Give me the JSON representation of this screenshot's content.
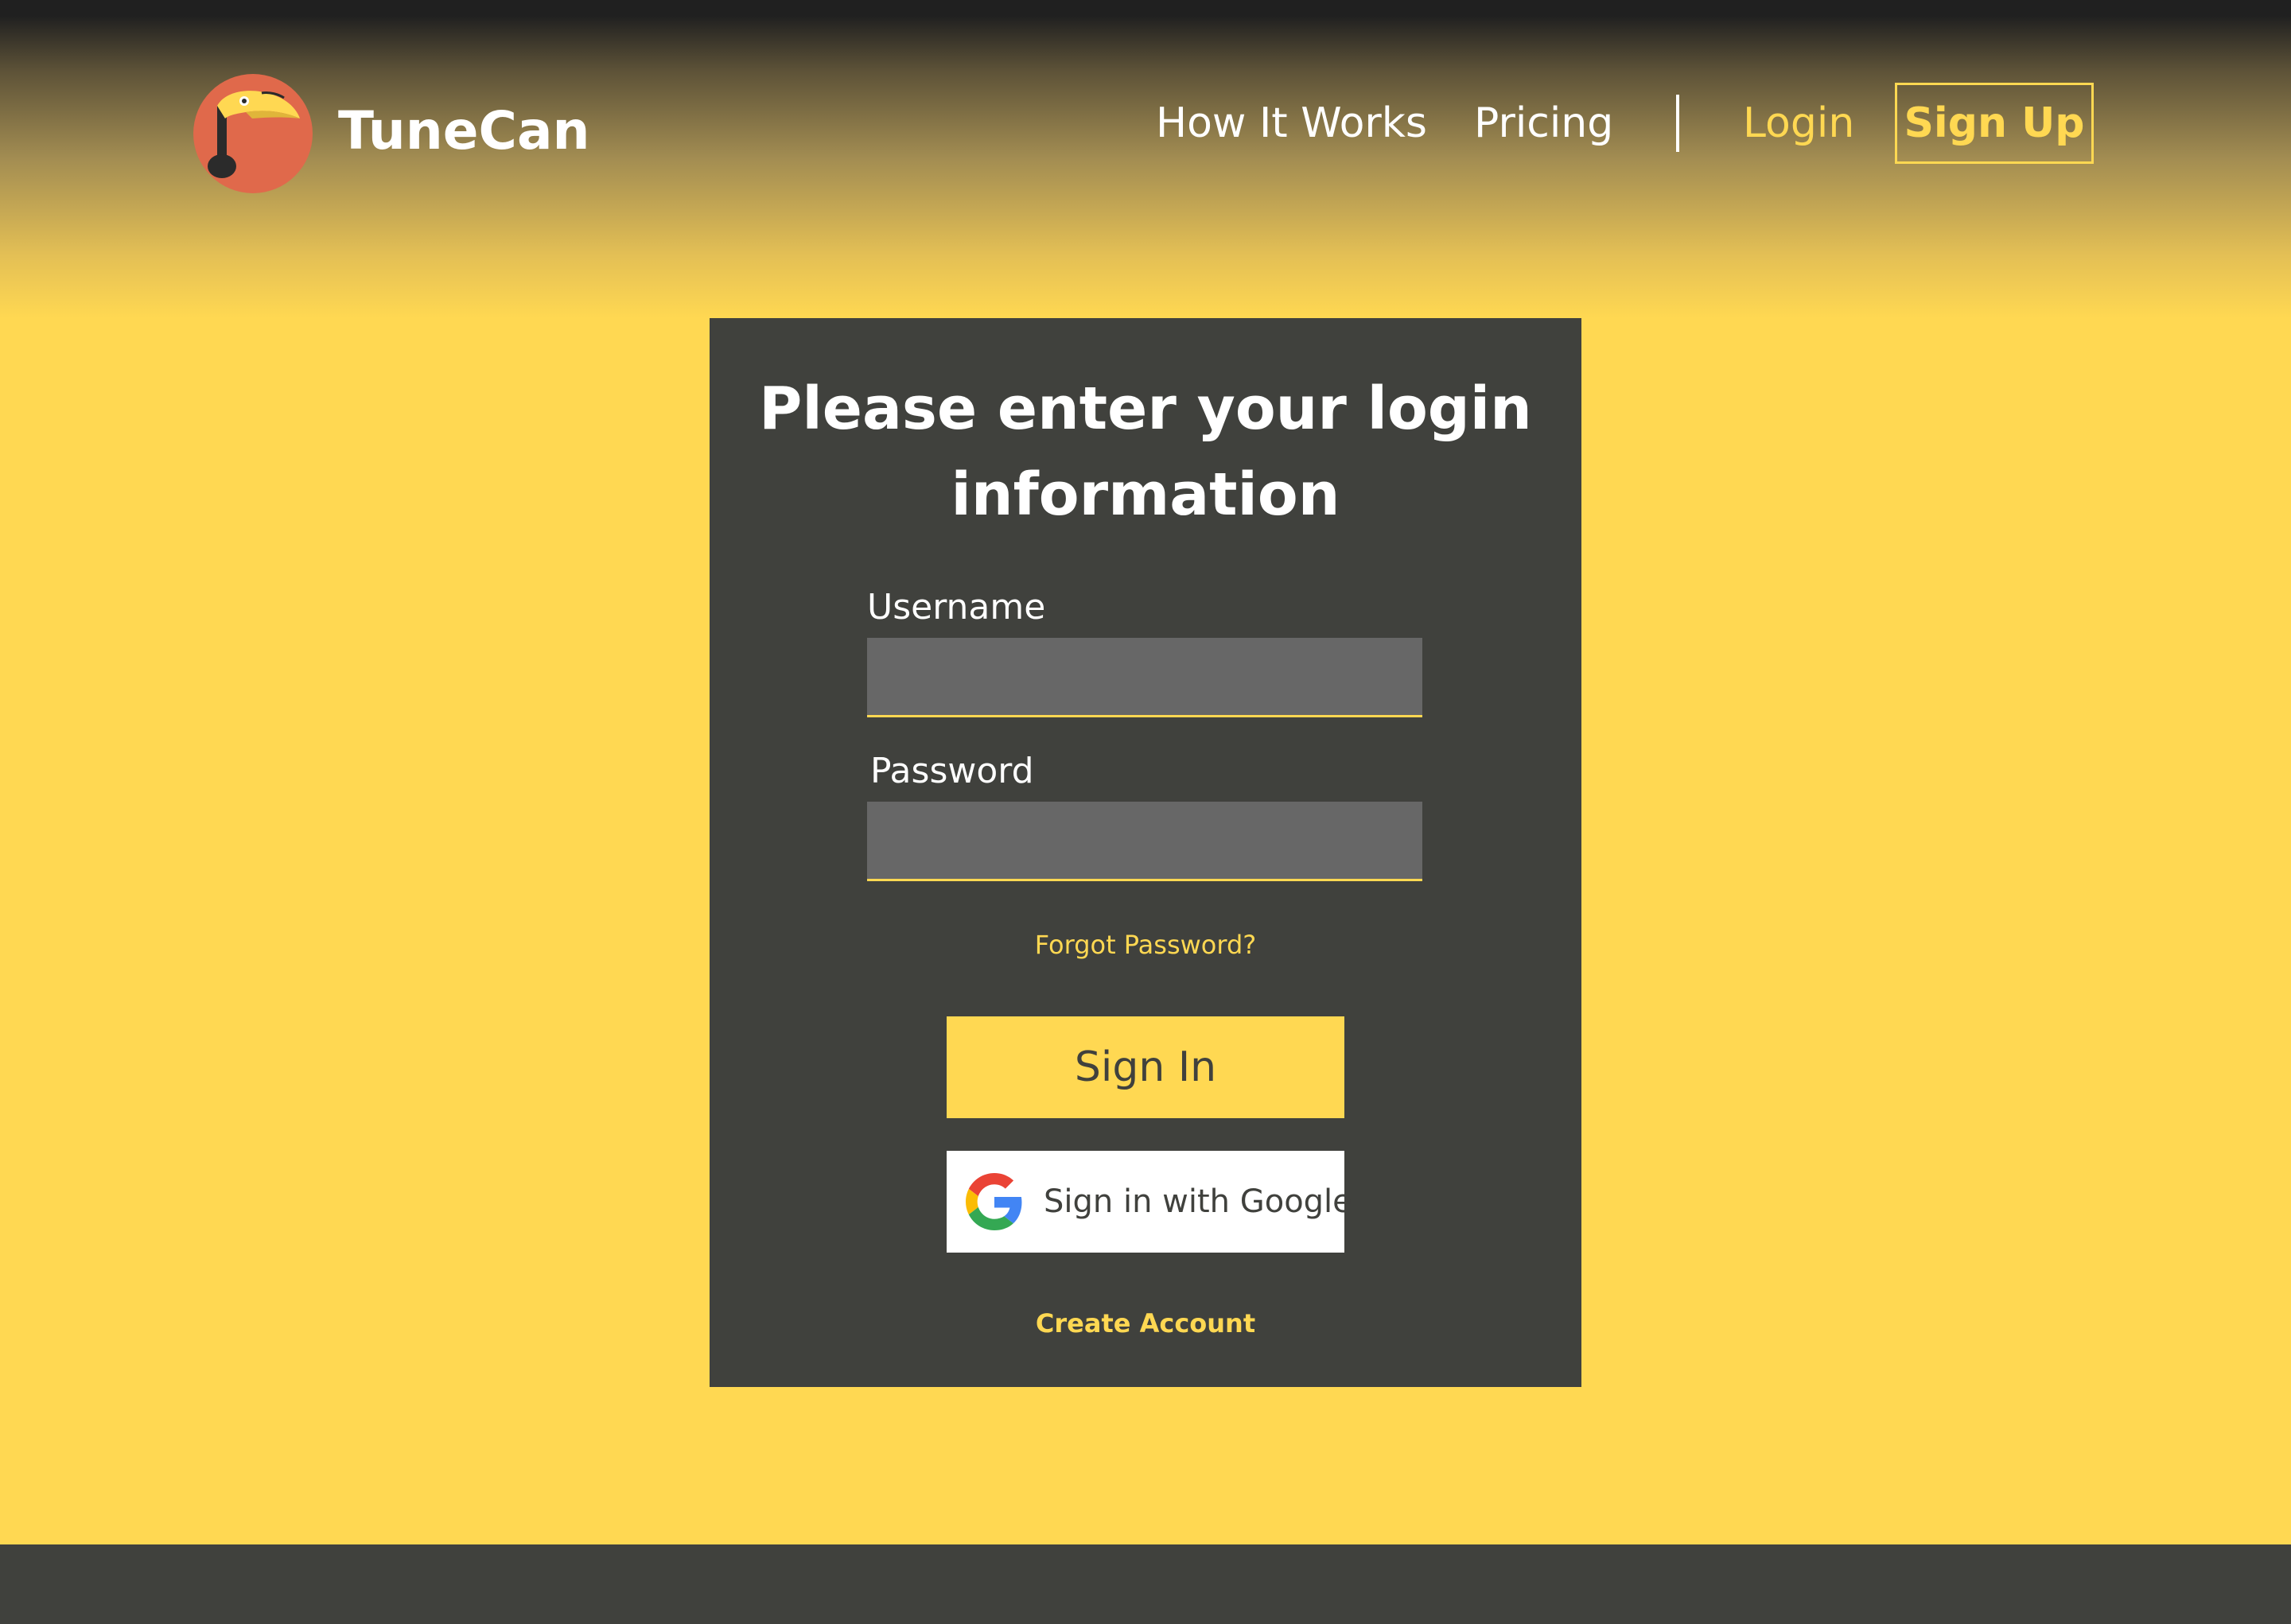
{
  "brand": {
    "name": "TuneCan",
    "logo_icon": "toucan-music-note-icon"
  },
  "nav": {
    "how_it_works": "How It Works",
    "pricing": "Pricing",
    "login": "Login",
    "sign_up": "Sign Up"
  },
  "login_form": {
    "title": "Please enter your login information",
    "username_label": "Username",
    "username_value": "",
    "password_label": "Password",
    "password_value": "",
    "forgot_password": "Forgot Password?",
    "sign_in": "Sign In",
    "google_sign_in": "Sign in with Google",
    "google_icon": "google-g-icon",
    "create_account": "Create Account"
  },
  "colors": {
    "accent_yellow": "#FFD852",
    "card_dark": "#40413D",
    "input_gray": "#676767",
    "logo_orange": "#E0694B",
    "header_dark": "#202020"
  }
}
